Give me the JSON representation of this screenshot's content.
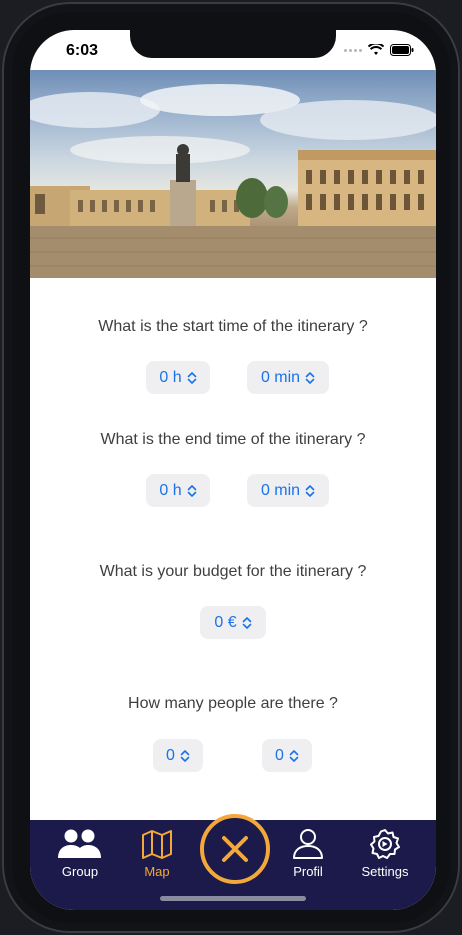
{
  "status_bar": {
    "time": "6:03"
  },
  "questions": {
    "start_time": "What is the start time of the itinerary ?",
    "end_time": "What is the end time of the itinerary ?",
    "budget": "What is your budget for the itinerary ?",
    "people": "How many people are there ?"
  },
  "pickers": {
    "start_hours": "0 h",
    "start_minutes": "0 min",
    "end_hours": "0 h",
    "end_minutes": "0 min",
    "budget": "0 €",
    "people_a": "0",
    "people_b": "0"
  },
  "tabs": [
    {
      "label": "Group",
      "icon": "group-icon"
    },
    {
      "label": "Map",
      "icon": "map-icon"
    },
    {
      "label": "Profil",
      "icon": "profile-icon"
    },
    {
      "label": "Settings",
      "icon": "settings-icon"
    }
  ],
  "center_action": {
    "icon": "close-icon"
  },
  "colors": {
    "accent": "#1a73e8",
    "tabbar_bg": "#1b1a4a",
    "active_tab": "#f3a83b",
    "picker_bg": "#efeff2"
  }
}
